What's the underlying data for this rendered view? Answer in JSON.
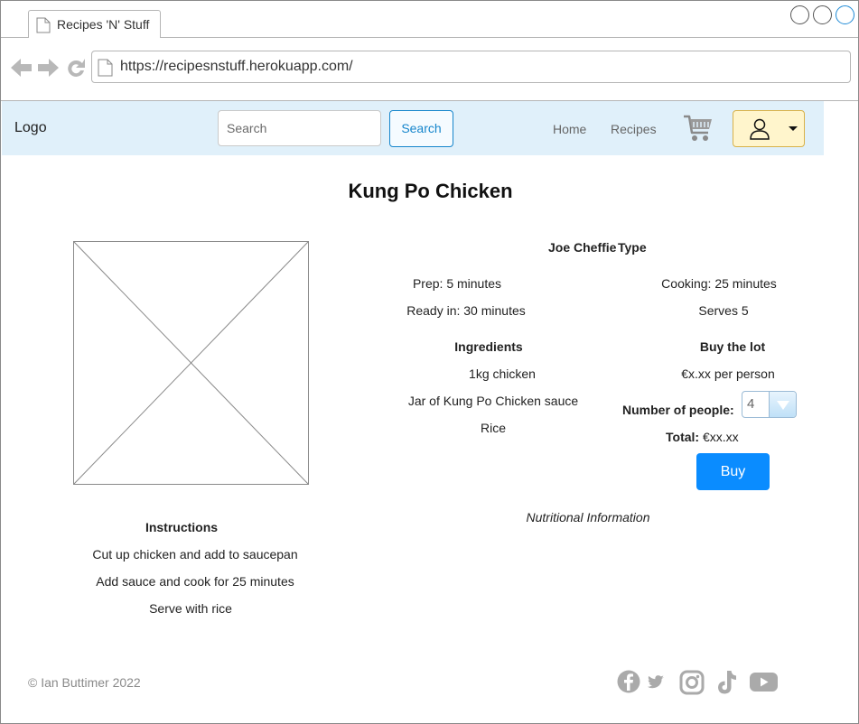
{
  "browser": {
    "tab_title": "Recipes 'N' Stuff",
    "url": "https://recipesnstuff.herokuapp.com/"
  },
  "navbar": {
    "logo": "Logo",
    "search_placeholder": "Search",
    "search_button": "Search",
    "links": [
      "Home",
      "Recipes"
    ]
  },
  "recipe": {
    "title": "Kung Po Chicken",
    "author": "Joe Cheffie",
    "type": "Type",
    "prep": "Prep: 5 minutes",
    "cooking": "Cooking: 25 minutes",
    "ready": "Ready in: 30 minutes",
    "serves": "Serves 5",
    "ingredients_heading": "Ingredients",
    "ingredients": [
      "1kg chicken",
      "Jar of Kung Po Chicken sauce",
      "Rice"
    ],
    "instructions_heading": "Instructions",
    "instructions": [
      "Cut up chicken and add to saucepan",
      "Add sauce and cook for 25 minutes",
      "Serve with rice"
    ],
    "nutrition_link": "Nutritional Information"
  },
  "purchase": {
    "heading": "Buy the lot",
    "price_per_person": "€x.xx per person",
    "people_label": "Number of people:",
    "people_value": "4",
    "total_label": "Total:",
    "total_value": "€xx.xx",
    "buy_button": "Buy"
  },
  "footer": {
    "copyright": "© Ian Buttimer 2022"
  },
  "colors": {
    "navbar_bg": "#e0f0fa",
    "primary": "#0a8cff",
    "account_bg": "#fff5cc",
    "social_grey": "#aaaaaa"
  }
}
